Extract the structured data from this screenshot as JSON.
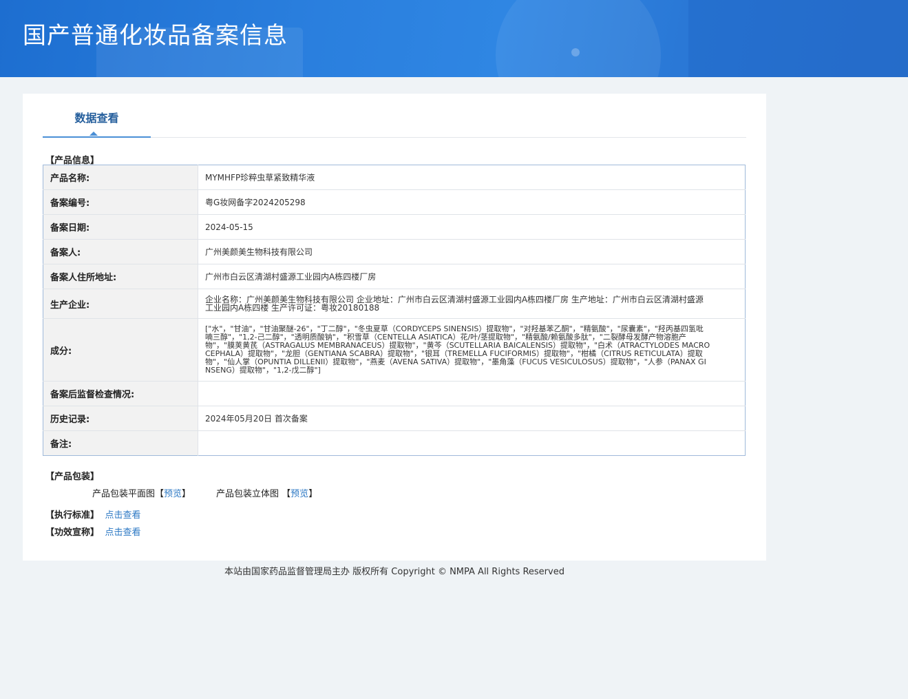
{
  "header": {
    "title": "国产普通化妆品备案信息"
  },
  "tabs": [
    {
      "label": "数据查看",
      "active": true
    }
  ],
  "sections": {
    "product_info": "【产品信息】",
    "packaging": "【产品包装】",
    "standard": "【执行标准】",
    "claims": "【功效宣称】"
  },
  "product_info": {
    "rows": [
      {
        "label": "产品名称:",
        "value": "MYMHFP珍粹虫草紧致精华液"
      },
      {
        "label": "备案编号:",
        "value": "粤G妆网备字2024205298"
      },
      {
        "label": "备案日期:",
        "value": "2024-05-15"
      },
      {
        "label": "备案人:",
        "value": "广州美颜美生物科技有限公司"
      },
      {
        "label": "备案人住所地址:",
        "value": "广州市白云区清湖村盛源工业园内A栋四楼厂房"
      },
      {
        "label": "生产企业:",
        "value": "企业名称：广州美颜美生物科技有限公司 企业地址：广州市白云区清湖村盛源工业园内A栋四楼厂房 生产地址：广州市白云区清湖村盛源工业园内A栋四楼 生产许可证：粤妆20180188"
      },
      {
        "label": "成分:",
        "value": "[\"水\"，\"甘油\"，\"甘油聚醚-26\"，\"丁二醇\"，\"冬虫夏草（CORDYCEPS SINENSIS）提取物\"，\"对羟基苯乙酮\"，\"精氨酸\"，\"尿囊素\"，\"羟丙基四氢吡喃三醇\"，\"1,2-己二醇\"，\"透明质酸钠\"，\"积雪草（CENTELLA ASIATICA）花/叶/茎提取物\"，\"精氨酸/赖氨酸多肽\"，\"二裂酵母发酵产物溶胞产物\"，\"膜荚黄芪（ASTRAGALUS MEMBRANACEUS）提取物\"，\"黄芩（SCUTELLARIA BAICALENSIS）提取物\"，\"白术（ATRACTYLODES MACROCEPHALA）提取物\"，\"龙胆（GENTIANA SCABRA）提取物\"，\"银耳（TREMELLA FUCIFORMIS）提取物\"，\"柑橘（CITRUS RETICULATA）提取物\"，\"仙人掌（OPUNTIA DILLENII）提取物\"，\"燕麦（AVENA SATIVA）提取物\"，\"墨角藻（FUCUS VESICULOSUS）提取物\"，\"人参（PANAX GINSENG）提取物\"，\"1,2-戊二醇\"]"
      },
      {
        "label": "备案后监督检查情况:",
        "value": ""
      },
      {
        "label": "历史记录:",
        "value": "2024年05月20日 首次备案"
      },
      {
        "label": "备注:",
        "value": ""
      }
    ]
  },
  "packaging": {
    "flat_label": "产品包装平面图",
    "stereo_label": "产品包装立体图",
    "bracket_open": "【",
    "bracket_close": "】",
    "preview_link": "预览"
  },
  "standard_link": "点击查看",
  "claims_link": "点击查看",
  "footer": {
    "text": "本站由国家药品监督管理局主办 版权所有 Copyright © NMPA All Rights Reserved"
  }
}
